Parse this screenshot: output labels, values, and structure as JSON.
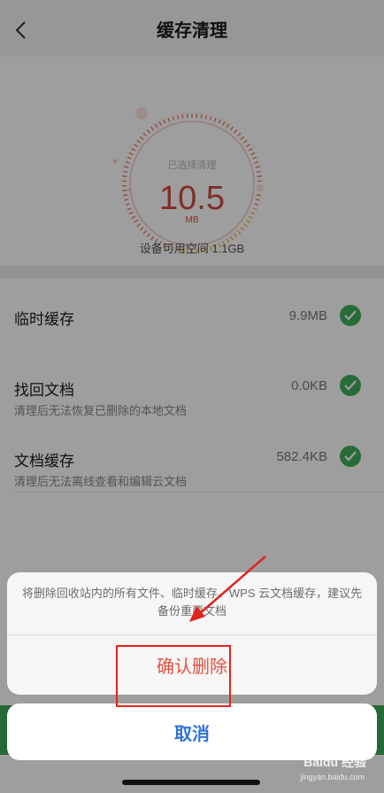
{
  "header": {
    "title": "缓存清理",
    "back_icon": "chevron-left-icon"
  },
  "gauge": {
    "label": "已选择清理",
    "value": "10.5",
    "unit": "MB",
    "accent_color": "#d24a43"
  },
  "storage": {
    "available_text": "设备可用空间 1.1GB"
  },
  "items": [
    {
      "name": "临时缓存",
      "size": "9.9MB",
      "checked": true
    },
    {
      "name": "找回文档",
      "description": "清理后无法恢复已删除的本地文档",
      "size": "0.0KB",
      "checked": true
    },
    {
      "name": "文档缓存",
      "description": "清理后无法离线查看和编辑云文档",
      "size": "582.4KB",
      "checked": true
    }
  ],
  "dialog": {
    "message": "将删除回收站内的所有文件、临时缓存、WPS 云文档缓存，建议先备份重要文档",
    "confirm_label": "确认删除",
    "cancel_label": "取消"
  },
  "watermark": {
    "text": "Baidu 经验",
    "sub": "jingyan.baidu.com"
  },
  "colors": {
    "check": "#3fae5a",
    "confirm": "#e2503f",
    "cancel": "#2f73d8",
    "annotation": "#e3231e"
  }
}
